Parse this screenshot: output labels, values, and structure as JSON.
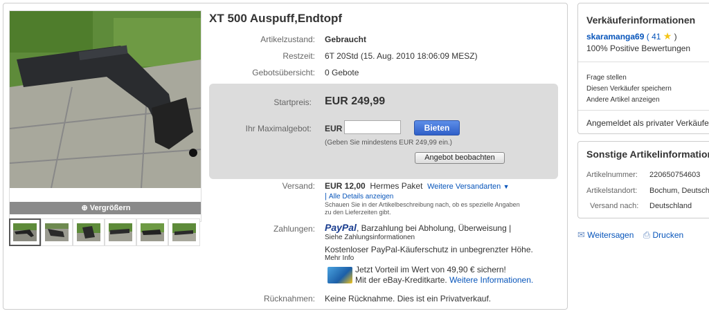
{
  "item": {
    "title": "XT 500 Auspuff,Endtopf",
    "enlarge_label": "Vergrößern",
    "condition_label": "Artikelzustand:",
    "condition_value": "Gebraucht",
    "time_label": "Restzeit:",
    "time_value": "6T 20Std (15. Aug. 2010 18:06:09 MESZ)",
    "bids_label": "Gebotsübersicht:",
    "bids_value": "0 Gebote"
  },
  "bid": {
    "start_label": "Startpreis:",
    "start_price": "EUR 249,99",
    "max_label": "Ihr Maximalgebot:",
    "currency": "EUR",
    "input_value": "",
    "bid_button": "Bieten",
    "min_hint": "(Geben Sie mindestens EUR 249,99 ein.)",
    "watch_button": "Angebot beobachten"
  },
  "shipping": {
    "label": "Versand:",
    "price": "EUR 12,00",
    "method": "Hermes Paket",
    "more_link": "Weitere Versandarten",
    "details_link": "Alle Details anzeigen",
    "note_line1": "Schauen Sie in der Artikelbeschreibung nach, ob es spezielle Angaben",
    "note_line2": "zu den Lieferzeiten gibt."
  },
  "payment": {
    "label": "Zahlungen:",
    "paypal_logo": "PayPal",
    "methods": ", Barzahlung bei Abholung, Überweisung |",
    "info_link": "Siehe Zahlungsinformationen",
    "protection": "Kostenloser PayPal-Käuferschutz in unbegrenzter Höhe.",
    "more_info": "Mehr Info",
    "promo_line1": "Jetzt Vorteil im Wert von 49,90 € sichern!",
    "promo_line2": "Mit der eBay-Kreditkarte.",
    "promo_link": "Weitere Informationen."
  },
  "returns": {
    "label": "Rücknahmen:",
    "value": "Keine Rücknahme. Dies ist ein Privatverkauf."
  },
  "seller": {
    "title": "Verkäuferinformationen",
    "name": "skaramanga69",
    "rating_open": "( 41",
    "rating_close": ")",
    "positive": "100% Positive Bewertungen",
    "link_question": "Frage stellen",
    "link_save": "Diesen Verkäufer speichern",
    "link_other": "Andere Artikel anzeigen",
    "registered": "Angemeldet als privater Verkäufer"
  },
  "other_info": {
    "title": "Sonstige Artikelinformationen",
    "item_number_label": "Artikelnummer:",
    "item_number": "220650754603",
    "location_label": "Artikelstandort:",
    "location": "Bochum, Deutschland",
    "ship_to_label": "Versand nach:",
    "ship_to": "Deutschland"
  },
  "actions": {
    "share": "Weitersagen",
    "print": "Drucken"
  },
  "colors": {
    "link": "#0654ba",
    "panel": "#dcdcdc",
    "bid_button": "#3a6bd6",
    "star": "#f5c518"
  },
  "icons": [
    "zoom-icon",
    "star-icon",
    "dropdown-arrow-icon",
    "mail-icon",
    "printer-icon",
    "credit-card-icon"
  ]
}
